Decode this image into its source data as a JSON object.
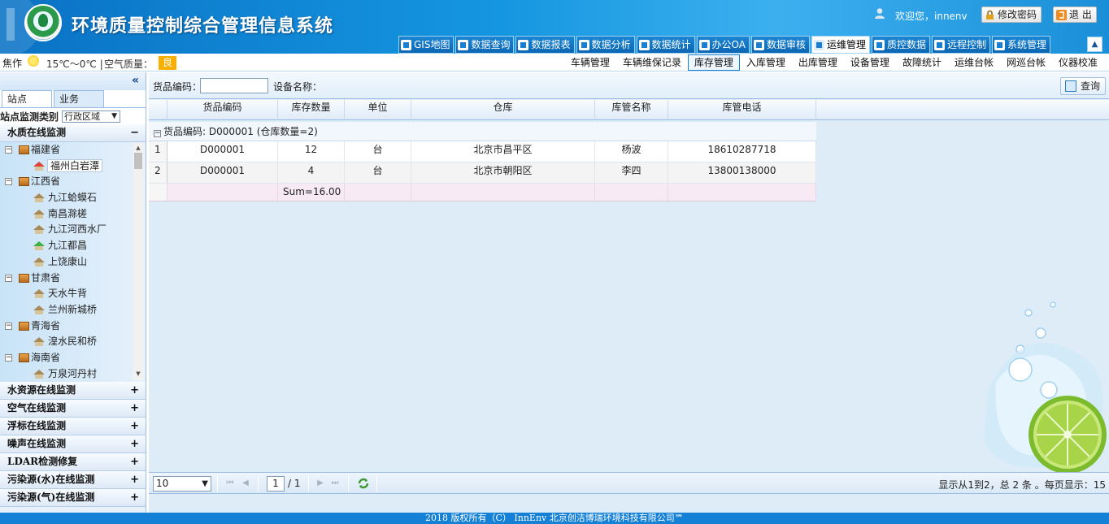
{
  "app": {
    "title": "环境质量控制综合管理信息系统"
  },
  "header": {
    "welcome": "欢迎您，innenv",
    "change_password": "修改密码",
    "logout": "退 出"
  },
  "nav_tabs": [
    {
      "label": "GIS地图",
      "icon": "map-icon"
    },
    {
      "label": "数据查询",
      "icon": "document-icon"
    },
    {
      "label": "数据报表",
      "icon": "report-icon"
    },
    {
      "label": "数据分析",
      "icon": "bar-chart-icon"
    },
    {
      "label": "数据统计",
      "icon": "gear-icon"
    },
    {
      "label": "办公OA",
      "icon": "office-icon"
    },
    {
      "label": "数据审核",
      "icon": "edit-icon"
    },
    {
      "label": "运维管理",
      "icon": "tools-icon",
      "active": true
    },
    {
      "label": "质控数据",
      "icon": "tools-icon"
    },
    {
      "label": "远程控制",
      "icon": "cloud-icon"
    },
    {
      "label": "系统管理",
      "icon": "gear-icon"
    }
  ],
  "status": {
    "city": "焦作",
    "temperature": "15℃～0℃",
    "separator": "|",
    "air_quality_label": "空气质量：",
    "air_quality_value": "良",
    "air_quality_color": "#f7b000"
  },
  "submenu": [
    "车辆管理",
    "车辆维保记录",
    "库存管理",
    "入库管理",
    "出库管理",
    "设备管理",
    "故障统计",
    "运维台帐",
    "网巡台帐",
    "仪器校准"
  ],
  "submenu_active": "库存管理",
  "sidebar": {
    "collapse_icon": "«",
    "tabs": [
      "站点",
      "业务"
    ],
    "category_label": "站点监测类别",
    "category_select": "行政区域",
    "open_group": "水质在线监测",
    "tree": [
      {
        "type": "province",
        "label": "福建省"
      },
      {
        "type": "site",
        "label": "福州白岩潭",
        "status": "red",
        "selected": true
      },
      {
        "type": "province",
        "label": "江西省"
      },
      {
        "type": "site",
        "label": "九江蛤蟆石"
      },
      {
        "type": "site",
        "label": "南昌滁槎"
      },
      {
        "type": "site",
        "label": "九江河西水厂"
      },
      {
        "type": "site",
        "label": "九江都昌",
        "status": "green"
      },
      {
        "type": "site",
        "label": "上饶康山"
      },
      {
        "type": "province",
        "label": "甘肃省"
      },
      {
        "type": "site",
        "label": "天水牛背"
      },
      {
        "type": "site",
        "label": "兰州新城桥"
      },
      {
        "type": "province",
        "label": "青海省"
      },
      {
        "type": "site",
        "label": "湟水民和桥"
      },
      {
        "type": "province",
        "label": "海南省"
      },
      {
        "type": "site",
        "label": "万泉河丹村"
      }
    ],
    "groups": [
      "水资源在线监测",
      "空气在线监测",
      "浮标在线监测",
      "噪声在线监测",
      "LDAR检测修复",
      "污染源(水)在线监测",
      "污染源(气)在线监测"
    ]
  },
  "search": {
    "code_label": "货品编码：",
    "code_value": "",
    "device_label": "设备名称：",
    "query_button": "查询"
  },
  "grid": {
    "columns": [
      "",
      "货品编码",
      "库存数量",
      "单位",
      "仓库",
      "库管名称",
      "库管电话"
    ],
    "group_label": "货品编码: D000001 (仓库数量=2)",
    "rows": [
      [
        "1",
        "D000001",
        "12",
        "台",
        "北京市昌平区",
        "杨波",
        "18610287718"
      ],
      [
        "2",
        "D000001",
        "4",
        "台",
        "北京市朝阳区",
        "李四",
        "13800138000"
      ]
    ],
    "sum": "Sum=16.00"
  },
  "pager": {
    "page_size": "10",
    "page": "1",
    "total_pages": "/ 1",
    "info": "显示从1到2，总 2 条 。每页显示：15"
  },
  "footer": "2018   版权所有（C） InnEnv 北京创洁博瑞环境科技有限公司℠"
}
